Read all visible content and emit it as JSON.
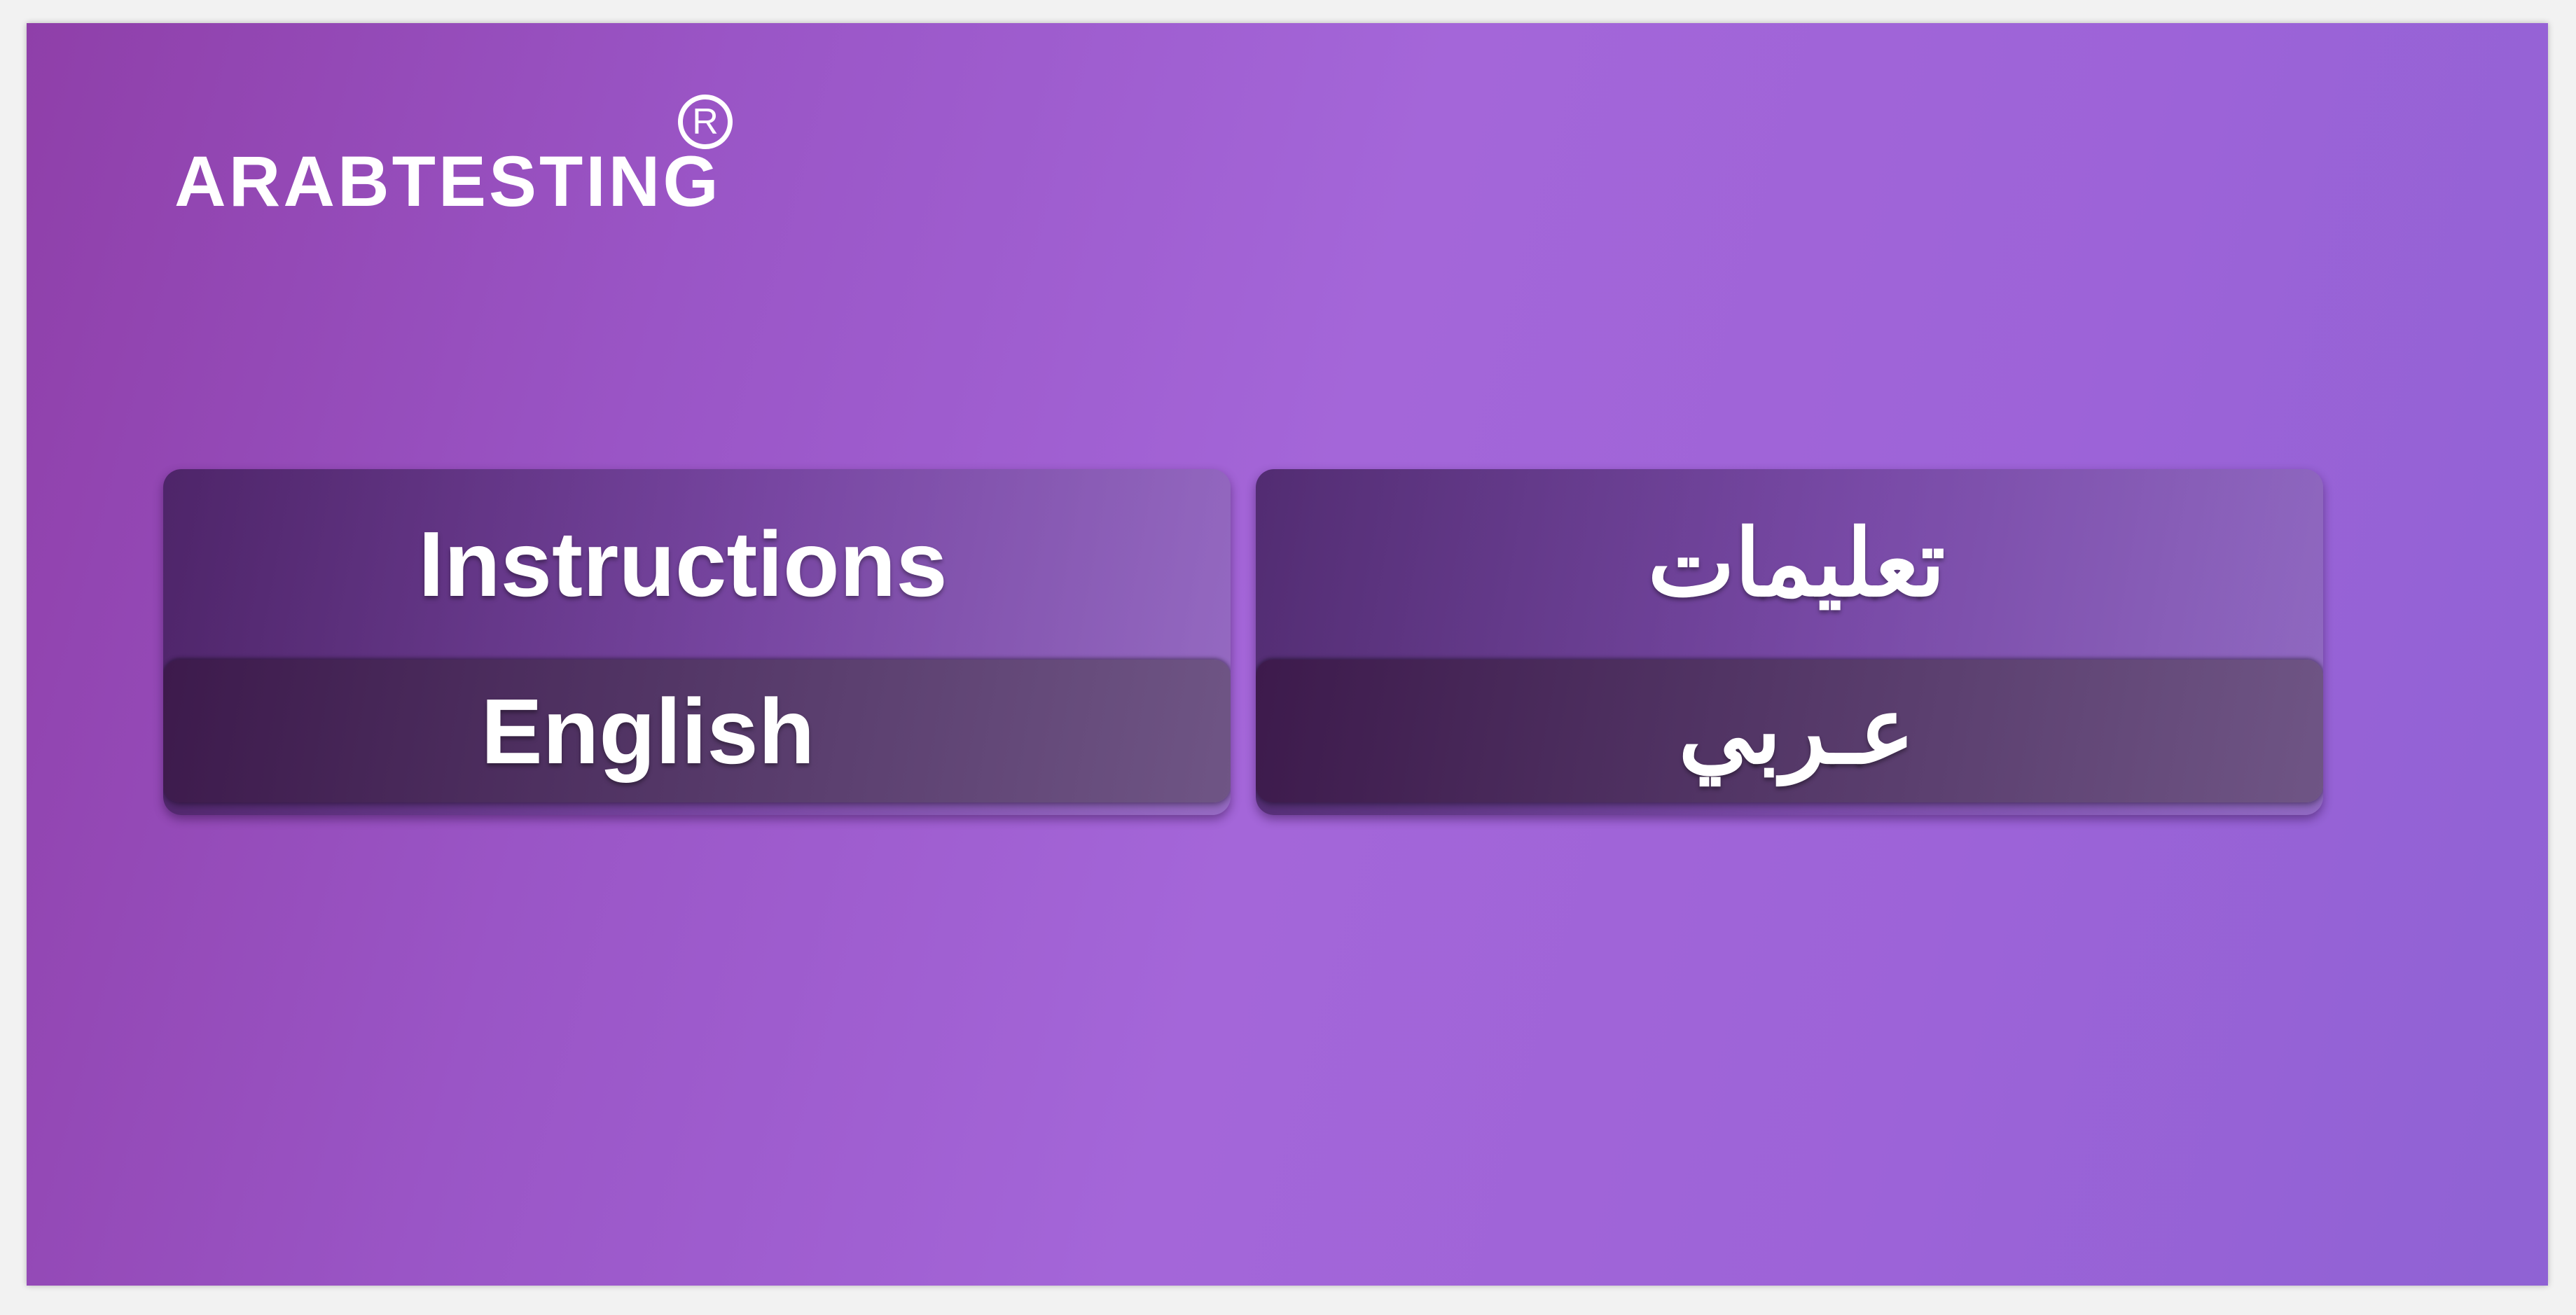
{
  "brand": {
    "name": "ARABTESTING",
    "registered_mark": "R"
  },
  "panels": [
    {
      "heading": "Instructions",
      "button_label": "English"
    },
    {
      "heading": "تعليمات",
      "button_label": "عـربي"
    }
  ],
  "colors": {
    "background_start": "#8f3fa9",
    "background_end": "#8f62d4",
    "text": "#ffffff"
  }
}
